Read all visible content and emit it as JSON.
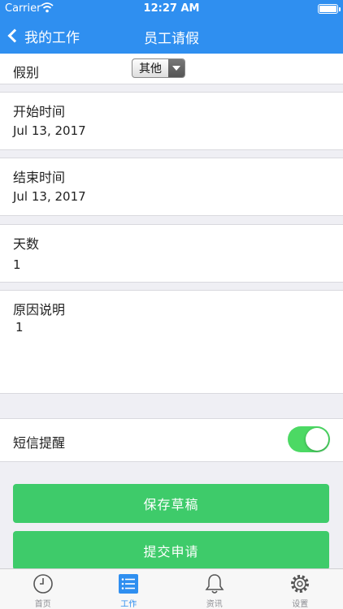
{
  "status_bar": {
    "carrier": "Carrier",
    "time": "12:27 AM"
  },
  "nav": {
    "back_label": "我的工作",
    "title": "员工请假"
  },
  "form": {
    "leave_type": {
      "label": "假别",
      "selected": "其他"
    },
    "start_time": {
      "label": "开始时间",
      "value": "Jul 13, 2017"
    },
    "end_time": {
      "label": "结束时间",
      "value": "Jul 13, 2017"
    },
    "days": {
      "label": "天数",
      "value": "1"
    },
    "reason": {
      "label": "原因说明",
      "value": "1"
    },
    "sms_reminder": {
      "label": "短信提醒",
      "enabled": true
    }
  },
  "buttons": {
    "save_draft": "保存草稿",
    "submit": "提交申请"
  },
  "tabbar": {
    "items": [
      {
        "label": "首页",
        "icon": "clock-icon"
      },
      {
        "label": "工作",
        "icon": "list-icon",
        "active": true
      },
      {
        "label": "资讯",
        "icon": "bell-icon"
      },
      {
        "label": "设置",
        "icon": "gear-icon"
      }
    ]
  },
  "colors": {
    "accent": "#2f8ff0",
    "button": "#3ecb6a",
    "toggle_on": "#4cd964"
  }
}
